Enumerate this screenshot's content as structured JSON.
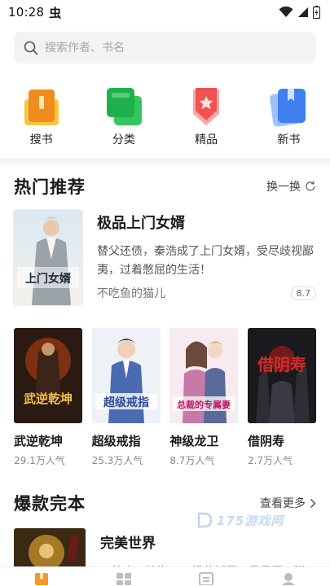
{
  "status_bar": {
    "time": "10:28",
    "app_glyph": "虫"
  },
  "search": {
    "placeholder": "搜索作者、书名"
  },
  "quick_nav": [
    {
      "label": "搜书",
      "icon": "search-book-icon",
      "color": "#f39a1f"
    },
    {
      "label": "分类",
      "icon": "category-icon",
      "color": "#2fc25b"
    },
    {
      "label": "精品",
      "icon": "premium-icon",
      "color": "#f05a5a"
    },
    {
      "label": "新书",
      "icon": "new-book-icon",
      "color": "#4c86f0"
    }
  ],
  "hot": {
    "title": "热门推荐",
    "action": "换一换",
    "featured": {
      "title": "极品上门女婿",
      "description": "替父还债，秦浩成了上门女婿，受尽歧视鄙夷，过着憋屈的生活！",
      "author": "不吃鱼的猫儿",
      "score": "8.7",
      "cover_text": "上门女婿"
    },
    "books": [
      {
        "title": "武逆乾坤",
        "popularity": "29.1万人气",
        "cover_text": "武逆乾坤"
      },
      {
        "title": "超级戒指",
        "popularity": "25.3万人气",
        "cover_text": "超级戒指"
      },
      {
        "title": "神级龙卫",
        "popularity": "8.7万人气",
        "cover_text": "总裁的专属妻"
      },
      {
        "title": "借阴寿",
        "popularity": "2.7万人气",
        "cover_text": "借阴寿"
      }
    ]
  },
  "complete": {
    "title": "爆款完本",
    "action": "查看更多",
    "book": {
      "title": "完美世界",
      "description": "一粒尘可填海，一根草斩尽日月星辰，弹"
    }
  },
  "watermark": "175游戏网",
  "tabs": [
    {
      "icon": "bookshelf-icon",
      "active": true
    },
    {
      "icon": "discover-icon",
      "active": false
    },
    {
      "icon": "list-icon",
      "active": false
    },
    {
      "icon": "profile-icon",
      "active": false
    }
  ],
  "colors": {
    "accent": "#f39a1f",
    "text": "#1a1a1a",
    "muted": "#888888"
  }
}
